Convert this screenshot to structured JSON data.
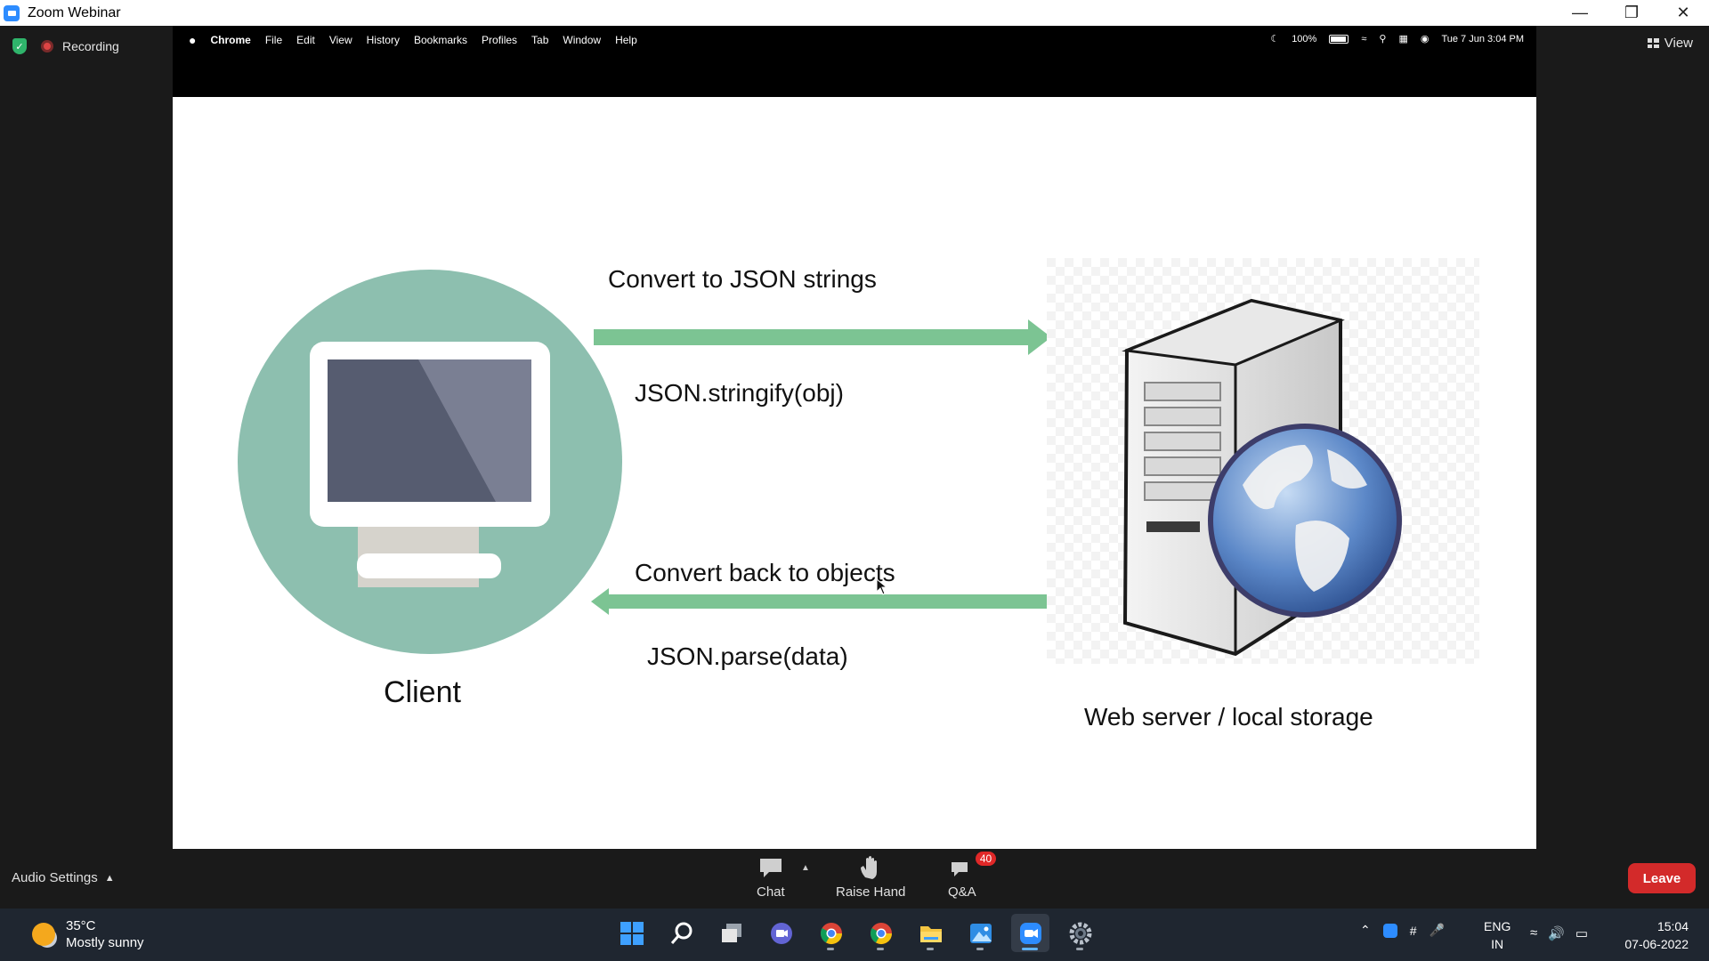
{
  "window": {
    "title": "Zoom Webinar"
  },
  "recording": {
    "label": "Recording"
  },
  "view": {
    "label": "View"
  },
  "mac": {
    "menu": [
      "Chrome",
      "File",
      "Edit",
      "View",
      "History",
      "Bookmarks",
      "Profiles",
      "Tab",
      "Window",
      "Help"
    ],
    "battery": "100%",
    "datetime": "Tue 7 Jun  3:04 PM"
  },
  "slide": {
    "client_label": "Client",
    "server_label": "Web server / local storage",
    "to_server_caption": "Convert to JSON strings",
    "to_server_code": "JSON.stringify(obj)",
    "to_client_caption": "Convert back to objects",
    "to_client_code": "JSON.parse(data)"
  },
  "toolbar": {
    "audio_settings": "Audio Settings",
    "chat": "Chat",
    "raise_hand": "Raise Hand",
    "qa": "Q&A",
    "qa_count": "40",
    "leave": "Leave"
  },
  "taskbar": {
    "temp": "35°C",
    "weather": "Mostly sunny",
    "lang_top": "ENG",
    "lang_bottom": "IN",
    "time": "15:04",
    "date": "07-06-2022",
    "apps": [
      "start-icon",
      "search-icon",
      "task-view-icon",
      "teams-chat-icon",
      "chrome-icon",
      "chrome-profile-icon",
      "file-explorer-icon",
      "photos-icon",
      "zoom-icon",
      "settings-icon"
    ]
  }
}
